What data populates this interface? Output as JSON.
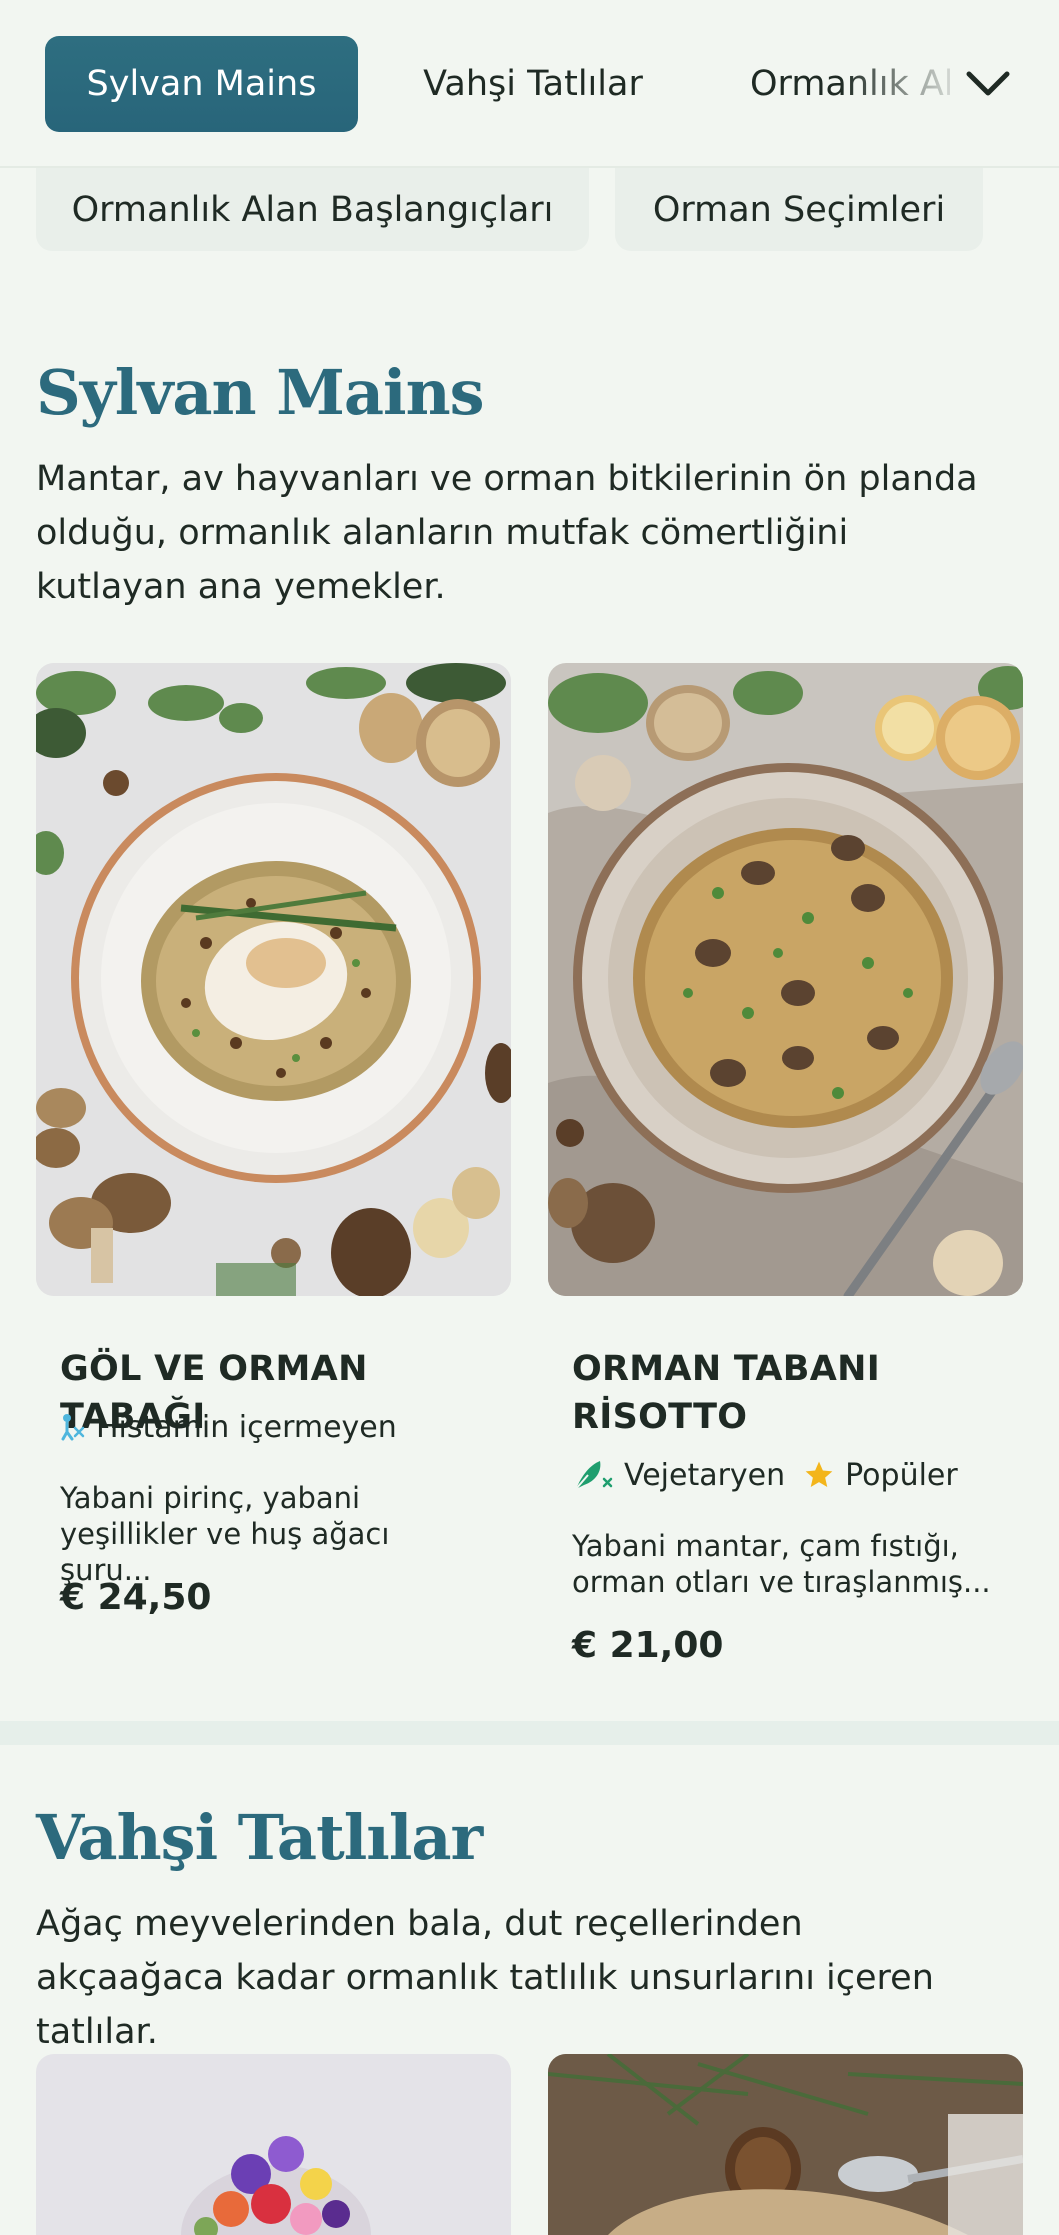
{
  "tabs": [
    {
      "label": "Sylvan Mains",
      "active": true
    },
    {
      "label": "Vahşi Tatlılar",
      "active": false
    },
    {
      "label": "Ormanlık Alan Başlangıçları",
      "active": false
    }
  ],
  "chips": [
    {
      "label": "Ormanlık Alan Başlangıçları"
    },
    {
      "label": "Orman Seçimleri"
    }
  ],
  "sections": [
    {
      "title": "Sylvan Mains",
      "description": "Mantar, av hayvanları ve orman bitkilerinin ön planda olduğu, ormanlık alanların mutfak cömertliğini kutlayan ana yemekler.",
      "dishes": [
        {
          "name": "GÖL VE ORMAN TABAĞI",
          "tags": [
            {
              "icon": "histamine-free-icon",
              "label": "Histamin içermeyen"
            }
          ],
          "description": "Yabani pirinç, yabani yeşillikler ve huş ağacı şuru...",
          "price": "€ 24,50"
        },
        {
          "name": "ORMAN TABANI RİSOTTO",
          "tags": [
            {
              "icon": "vegetarian-icon",
              "label": "Vejetaryen"
            },
            {
              "icon": "star-icon",
              "label": "Popüler"
            }
          ],
          "description": "Yabani mantar, çam fıstığı, orman otları ve tıraşlanmış...",
          "price": "€ 21,00"
        }
      ]
    },
    {
      "title": "Vahşi Tatlılar",
      "description": "Ağaç meyvelerinden bala, dut reçellerinden akçaağaca kadar ormanlık tatlılık unsurlarını içeren tatlılar."
    }
  ],
  "colors": {
    "accent": "#2c6a7d",
    "background": "#f2f6f1",
    "chip": "#e9efea",
    "histamine_icon": "#4fb6dd",
    "vegetarian_icon": "#1f9e6e",
    "star": "#f3b51b"
  }
}
